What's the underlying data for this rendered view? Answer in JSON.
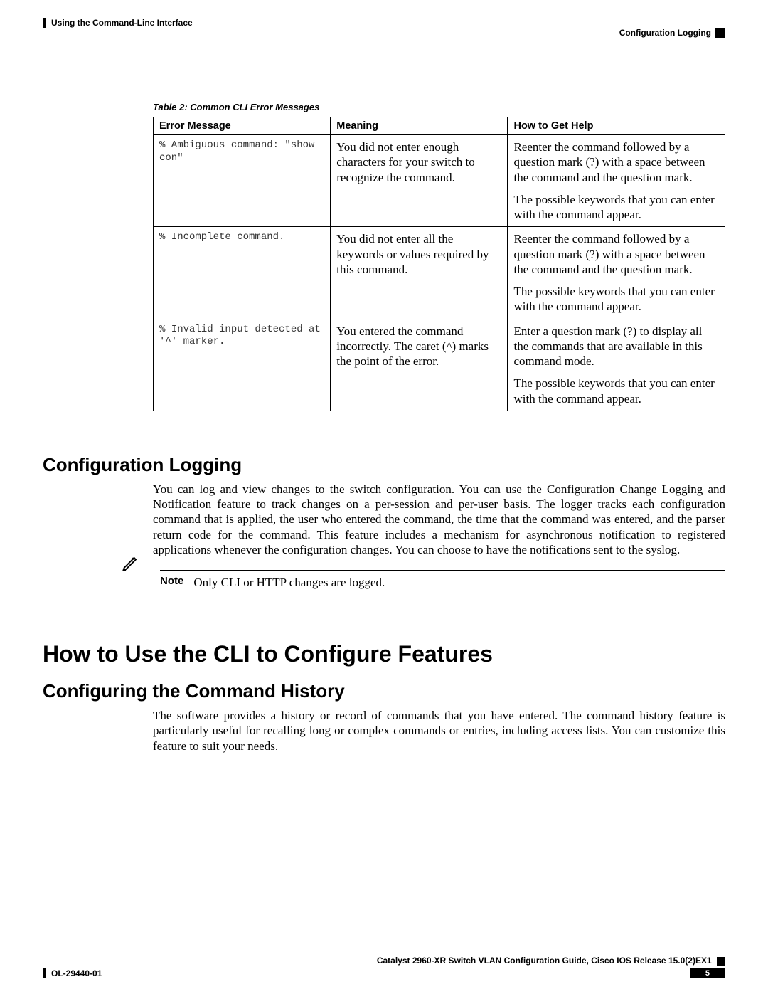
{
  "header": {
    "left": "Using the Command-Line Interface",
    "right": "Configuration Logging"
  },
  "table": {
    "caption": "Table 2: Common CLI Error Messages",
    "headers": {
      "error": "Error Message",
      "meaning": "Meaning",
      "help": "How to Get Help"
    },
    "rows": [
      {
        "error": "% Ambiguous command: \"show con\"",
        "meaning": "You did not enter enough characters for your switch to recognize the command.",
        "help_p1": "Reenter the command followed by a question mark (?) with a space between the command and the question mark.",
        "help_p2": "The possible keywords that you can enter with the command appear."
      },
      {
        "error": "% Incomplete command.",
        "meaning": "You did not enter all the keywords or values required by this command.",
        "help_p1": "Reenter the command followed by a question mark (?) with a space between the command and the question mark.",
        "help_p2": "The possible keywords that you can enter with the command appear."
      },
      {
        "error": "% Invalid input detected at '^' marker.",
        "meaning": "You entered the command incorrectly. The caret (^) marks the point of the error.",
        "help_p1": "Enter a question mark (?) to display all the commands that are available in this command mode.",
        "help_p2": "The possible keywords that you can enter with the command appear."
      }
    ]
  },
  "sections": {
    "config_logging": {
      "title": "Configuration Logging",
      "body": "You can log and view changes to the switch configuration. You can use the Configuration Change Logging and Notification feature to track changes on a per-session and per-user basis. The logger tracks each configuration command that is applied, the user who entered the command, the time that the command was entered, and the parser return code for the command. This feature includes a mechanism for asynchronous notification to registered applications whenever the configuration changes. You can choose to have the notifications sent to the syslog."
    },
    "note": {
      "label": "Note",
      "text": "Only CLI or HTTP changes are logged."
    },
    "how_to_cli": {
      "title": "How to Use the CLI to Configure Features"
    },
    "cmd_history": {
      "title": "Configuring the Command History",
      "body": "The software provides a history or record of commands that you have entered. The command history feature is particularly useful for recalling long or complex commands or entries, including access lists. You can customize this feature to suit your needs."
    }
  },
  "footer": {
    "guide": "Catalyst 2960-XR Switch VLAN Configuration Guide, Cisco IOS Release 15.0(2)EX1",
    "doc": "OL-29440-01",
    "page": "5"
  }
}
